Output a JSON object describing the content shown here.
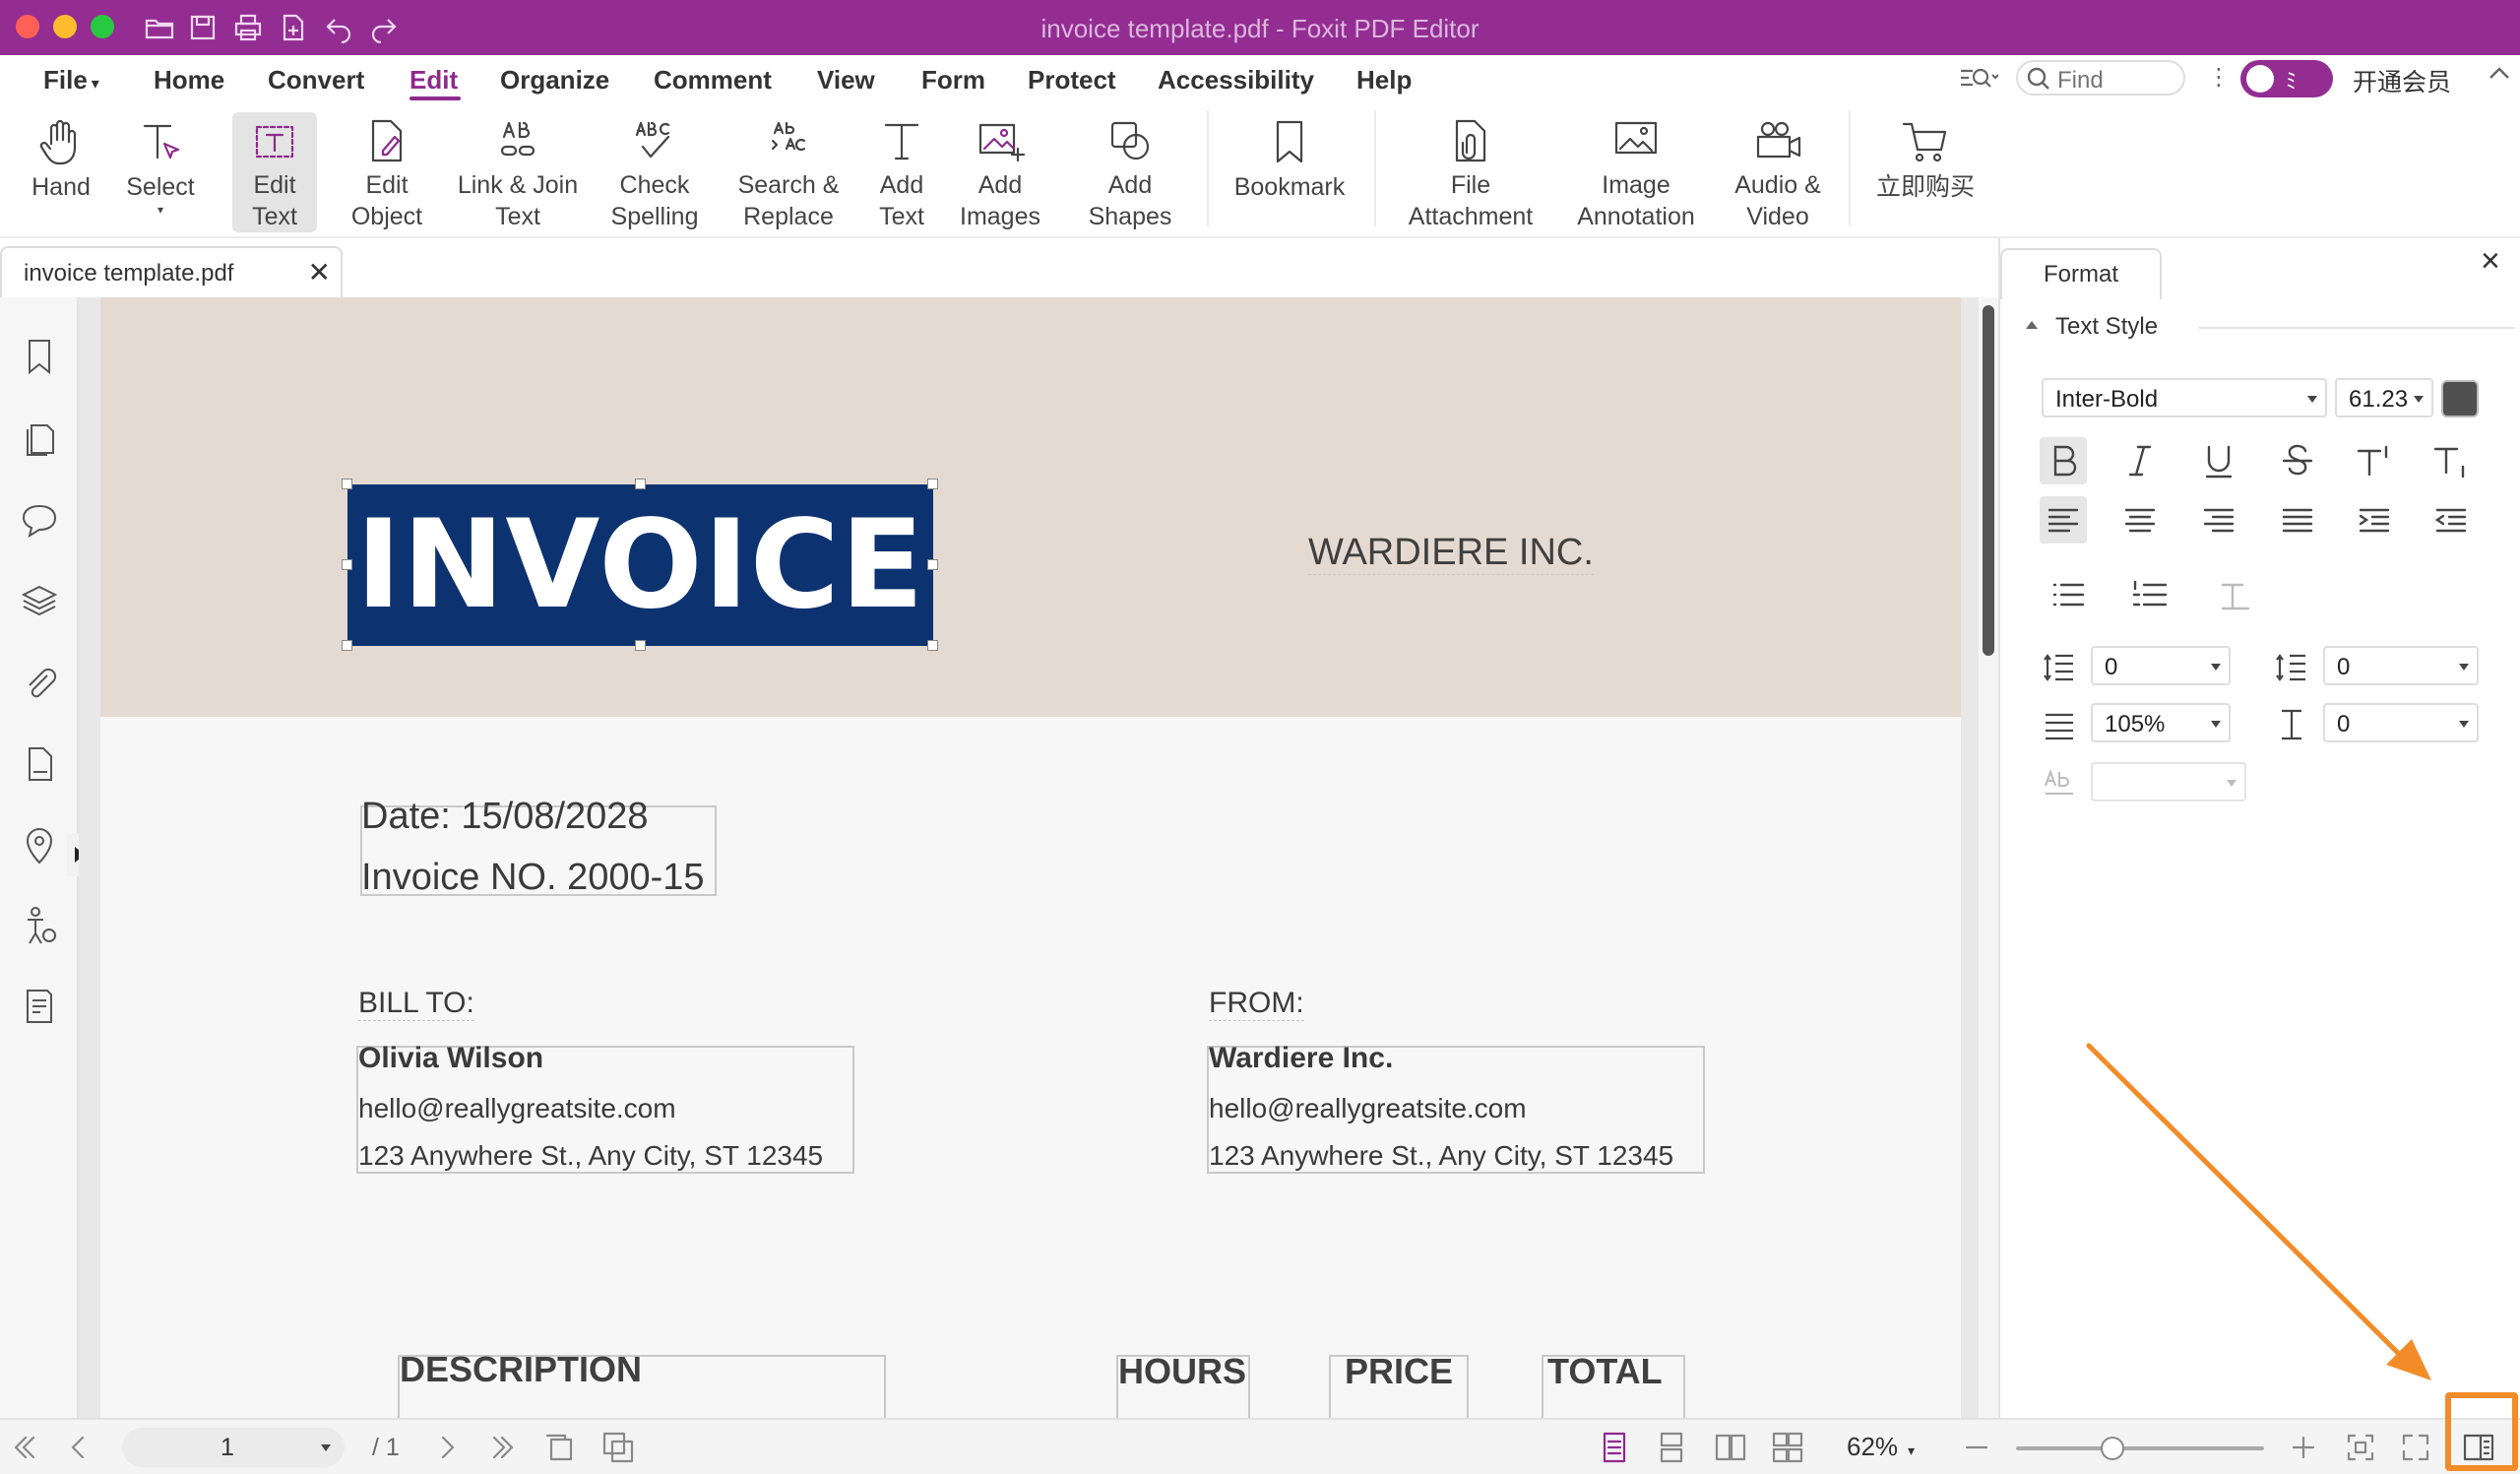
{
  "window": {
    "title": "invoice template.pdf - Foxit PDF Editor"
  },
  "menu": {
    "items": [
      "File",
      "Home",
      "Convert",
      "Edit",
      "Organize",
      "Comment",
      "View",
      "Form",
      "Protect",
      "Accessibility",
      "Help"
    ],
    "active": "Edit",
    "find_placeholder": "Find",
    "member_label": "开通会员"
  },
  "ribbon": {
    "buttons": [
      {
        "label": "Hand",
        "icon": "hand-icon"
      },
      {
        "label": "Select",
        "icon": "select-text-icon"
      },
      {
        "label": "Edit\nText",
        "icon": "edit-text-icon",
        "active": true
      },
      {
        "label": "Edit\nObject",
        "icon": "edit-object-icon"
      },
      {
        "label": "Link & Join\nText",
        "icon": "link-join-text-icon"
      },
      {
        "label": "Check\nSpelling",
        "icon": "check-spelling-icon"
      },
      {
        "label": "Search &\nReplace",
        "icon": "search-replace-icon"
      },
      {
        "label": "Add\nText",
        "icon": "add-text-icon"
      },
      {
        "label": "Add\nImages",
        "icon": "add-images-icon"
      },
      {
        "label": "Add\nShapes",
        "icon": "add-shapes-icon"
      },
      {
        "label": "Bookmark",
        "icon": "bookmark-icon"
      },
      {
        "label": "File\nAttachment",
        "icon": "file-attachment-icon"
      },
      {
        "label": "Image\nAnnotation",
        "icon": "image-annotation-icon"
      },
      {
        "label": "Audio &\nVideo",
        "icon": "audio-video-icon"
      },
      {
        "label": "立即购买",
        "icon": "cart-icon"
      }
    ]
  },
  "tabs": {
    "document": "invoice template.pdf",
    "close_symbol": "✕"
  },
  "document": {
    "invoice_title": "INVOICE",
    "company": "WARDIERE INC.",
    "date": "Date: 15/08/2028",
    "invoice_no": "Invoice NO. 2000-15",
    "bill_to_label": "BILL TO:",
    "bill_to_name": "Olivia  Wilson",
    "bill_to_email": "hello@reallygreatsite.com",
    "bill_to_address": "123 Anywhere St., Any City, ST 12345",
    "from_label": "FROM:",
    "from_name": "Wardiere Inc.",
    "from_email": "hello@reallygreatsite.com",
    "from_address": "123 Anywhere St., Any City, ST 12345",
    "columns": [
      "DESCRIPTION",
      "HOURS",
      "PRICE",
      "TOTAL"
    ],
    "colors": {
      "header_bg": "#e4dad2",
      "title_bg": "#0d3270",
      "page_bg": "#f8f7f8"
    }
  },
  "format_panel": {
    "tab_label": "Format",
    "section": "Text Style",
    "font": "Inter-Bold",
    "font_size": "61.23",
    "text_color": "#505050",
    "fields": {
      "line_spacing": "0",
      "paragraph_spacing": "0",
      "horizontal_scale": "105%",
      "baseline_offset": "0",
      "char_spacing": ""
    }
  },
  "status": {
    "page_current": "1",
    "page_total": "/ 1",
    "zoom": "62%",
    "zoom_slider_percent": 39
  },
  "accent_colors": {
    "titlebar": "#932d92",
    "brand": "#8e2a8e",
    "annotation": "#f28c28"
  }
}
